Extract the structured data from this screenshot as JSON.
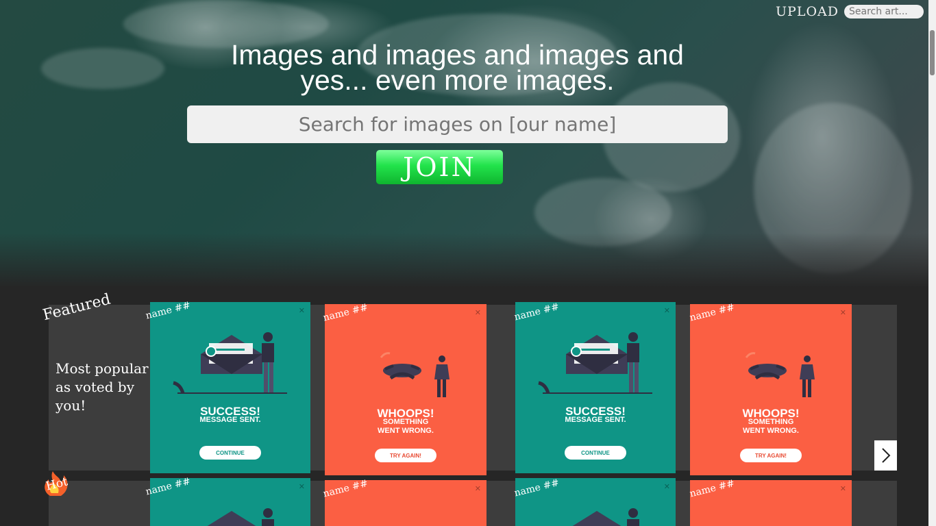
{
  "nav": {
    "upload_label": "UPLOAD",
    "search_placeholder": "Search art..."
  },
  "hero": {
    "headline_line1": "Images and images and images and",
    "headline_line2": "yes... even more images.",
    "search_placeholder": "Search for images on [our name]",
    "join_label": "JOIN"
  },
  "featured": {
    "label": "Featured",
    "tagline": "Most popular as voted by you!"
  },
  "hot": {
    "label": "Hot"
  },
  "card_name_label": "name ##",
  "cards": {
    "success": {
      "title": "SUCCESS!",
      "subtitle": "MESSAGE SENT.",
      "button": "CONTINUE"
    },
    "error": {
      "title": "WHOOPS!",
      "subtitle_line1": "SOMETHING",
      "subtitle_line2": "WENT WRONG.",
      "button": "TRY AGAIN!"
    }
  },
  "colors": {
    "success": "#0f9586",
    "error": "#fb5f43",
    "join": "#22e34b"
  },
  "icons": {
    "next": "chevron-right-icon",
    "hot": "fire-icon",
    "close": "close-icon"
  }
}
